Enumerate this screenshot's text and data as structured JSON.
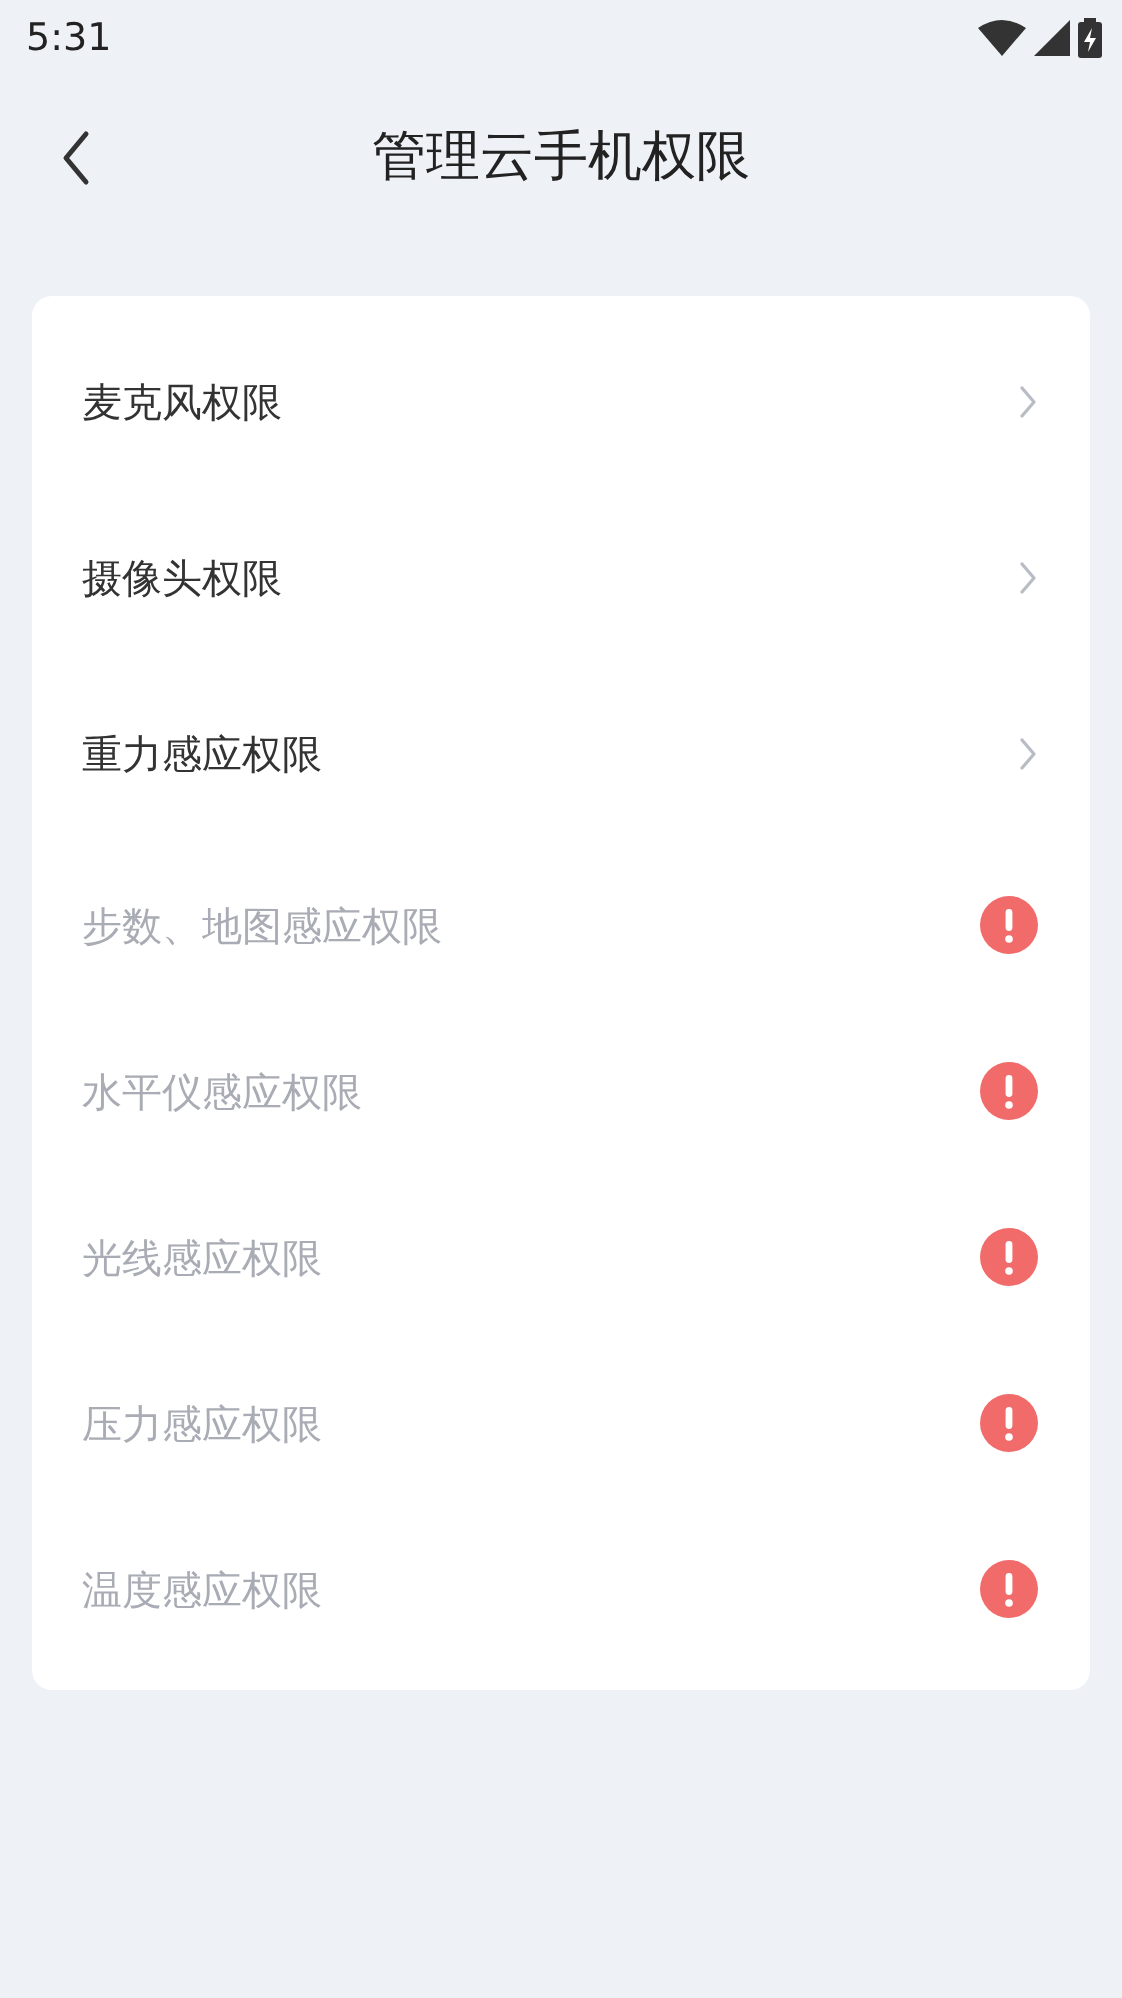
{
  "status_bar": {
    "time": "5:31"
  },
  "header": {
    "title": "管理云手机权限"
  },
  "permissions": [
    {
      "label": "麦克风权限",
      "disabled": false
    },
    {
      "label": "摄像头权限",
      "disabled": false
    },
    {
      "label": "重力感应权限",
      "disabled": false
    },
    {
      "label": "步数、地图感应权限",
      "disabled": true
    },
    {
      "label": "水平仪感应权限",
      "disabled": true
    },
    {
      "label": "光线感应权限",
      "disabled": true
    },
    {
      "label": "压力感应权限",
      "disabled": true
    },
    {
      "label": "温度感应权限",
      "disabled": true
    }
  ]
}
